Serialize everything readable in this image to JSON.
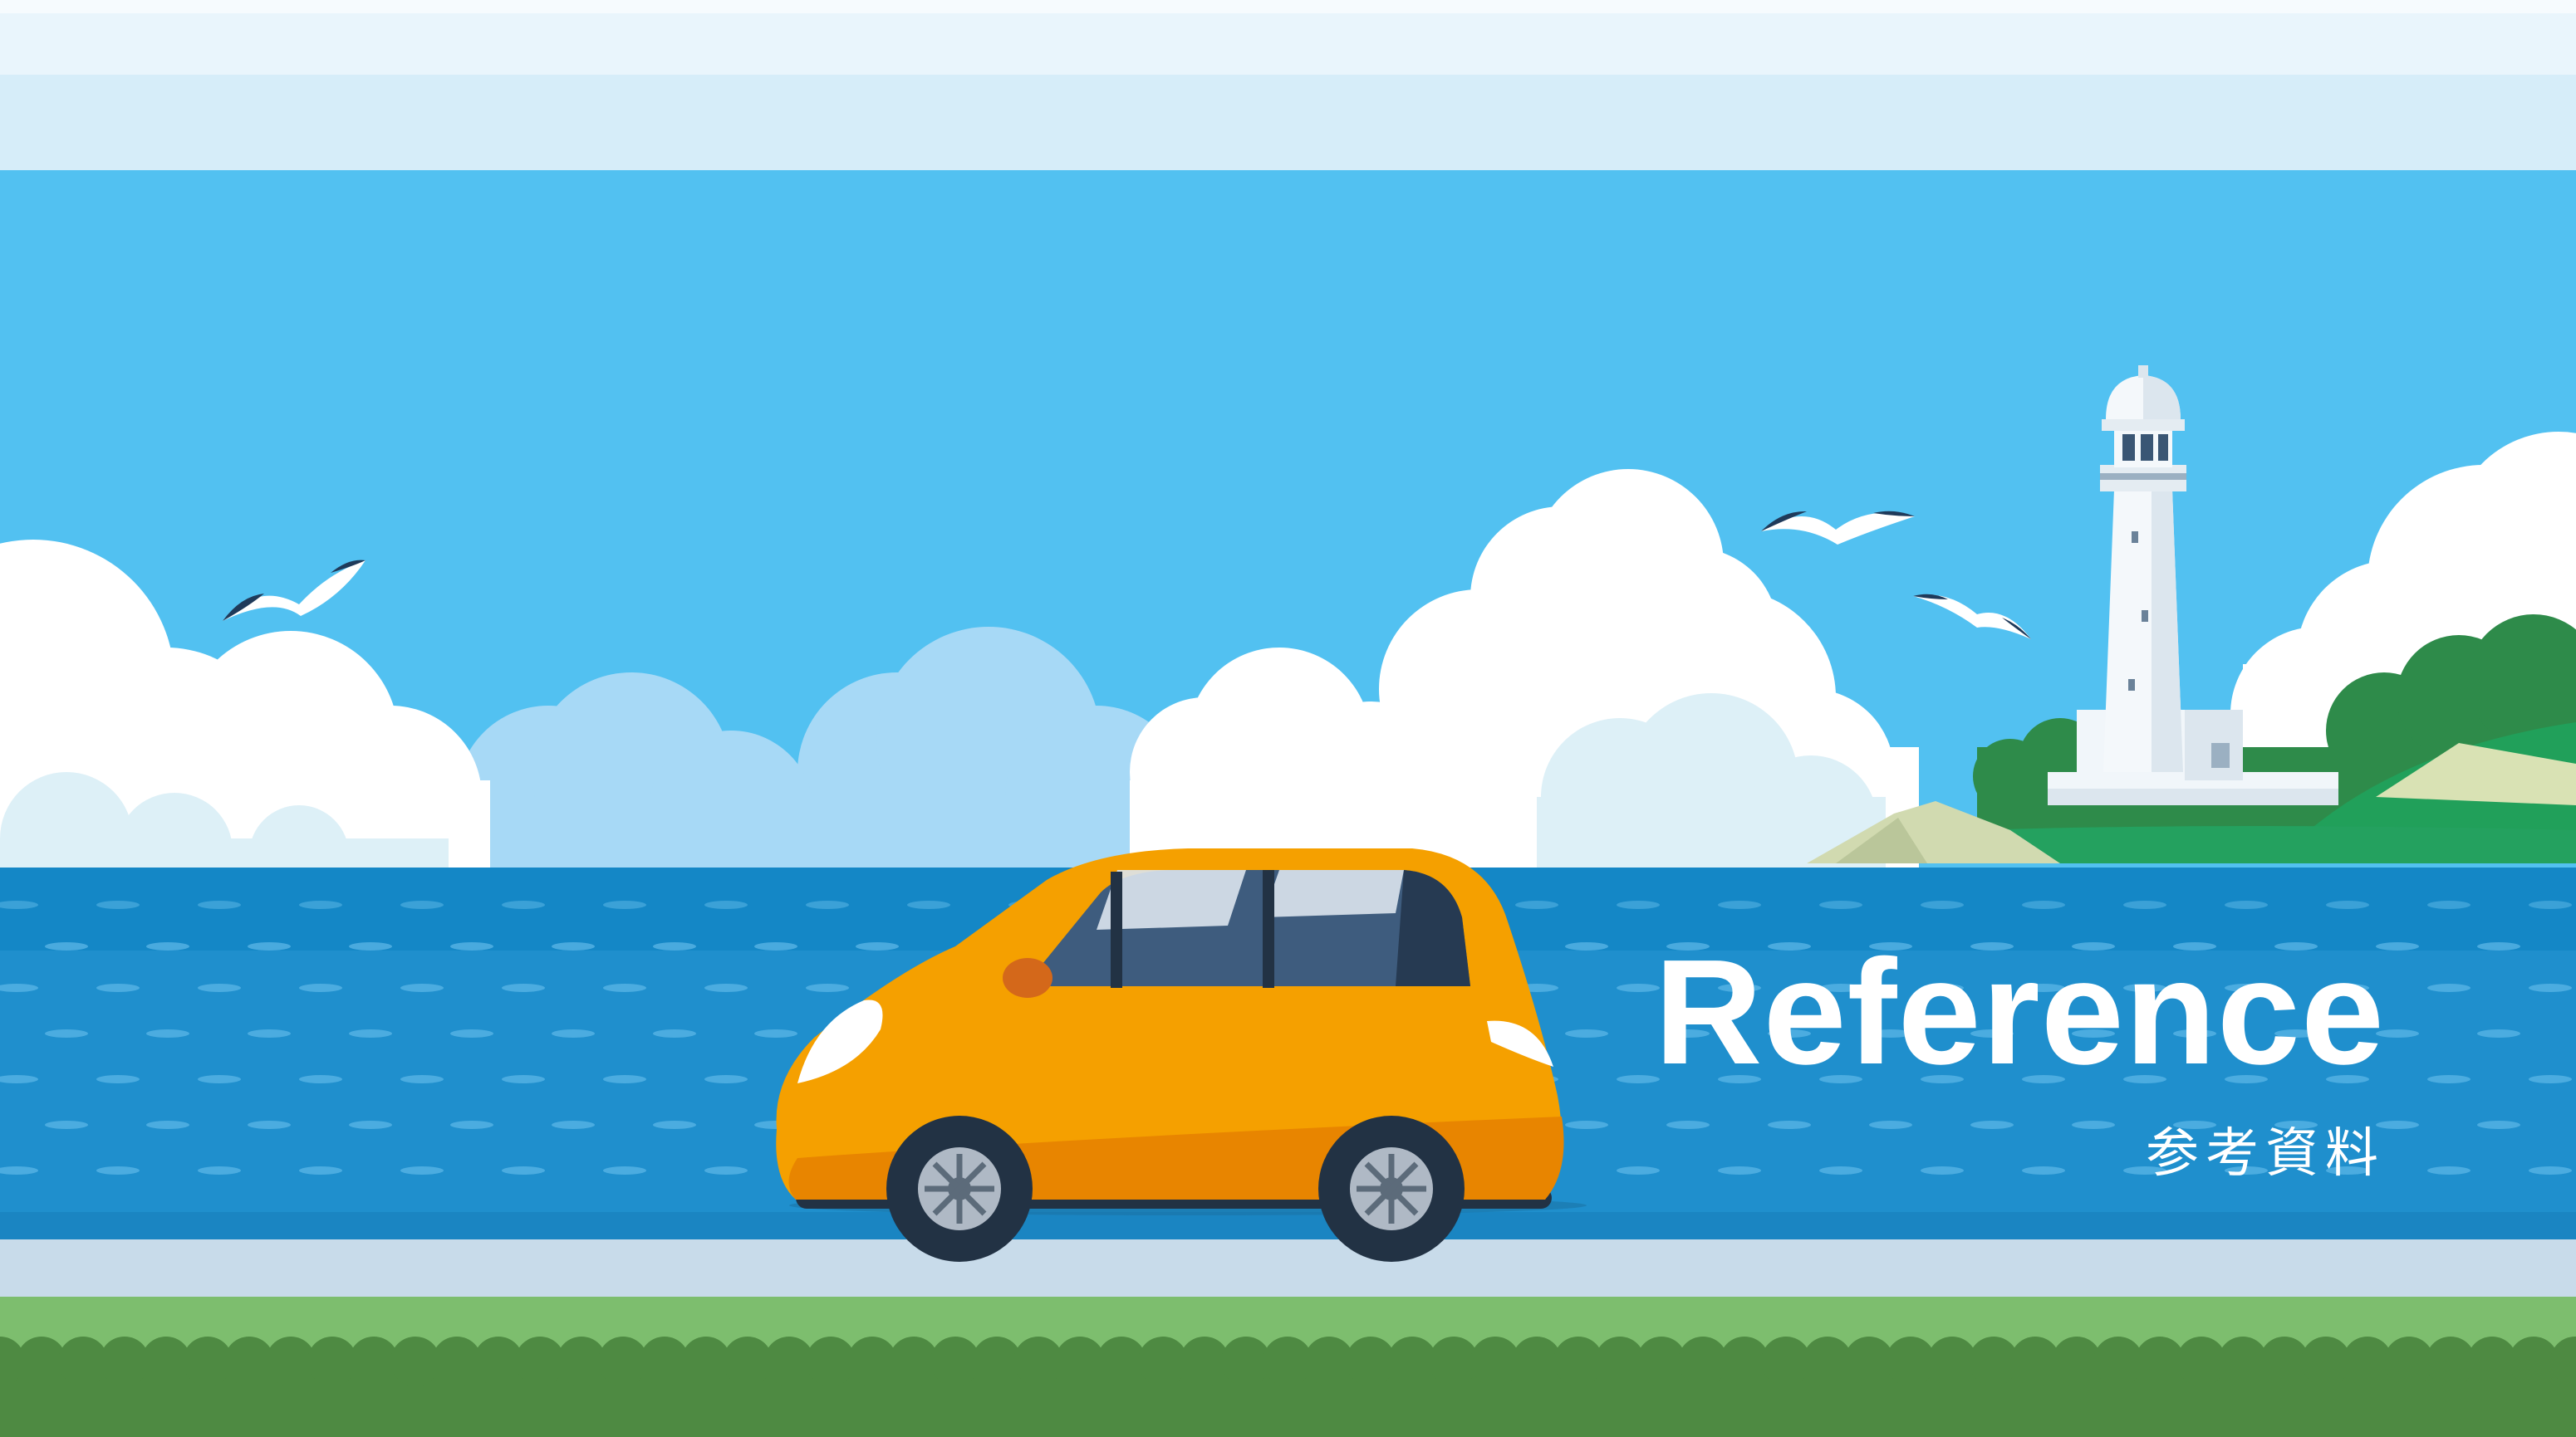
{
  "slide": {
    "title": "Reference",
    "subtitle": "参考資料"
  },
  "colors": {
    "sky": "#52C1F1",
    "sea": "#1F8FCD",
    "car": "#F5A000",
    "road": "#C8DBEA",
    "grass": "#7DBE6E",
    "hedge": "#4E8A42",
    "title_text": "#FFFFFF"
  },
  "icons": [
    "seagull-icon",
    "lighthouse-icon",
    "car-icon",
    "cloud-icon"
  ]
}
